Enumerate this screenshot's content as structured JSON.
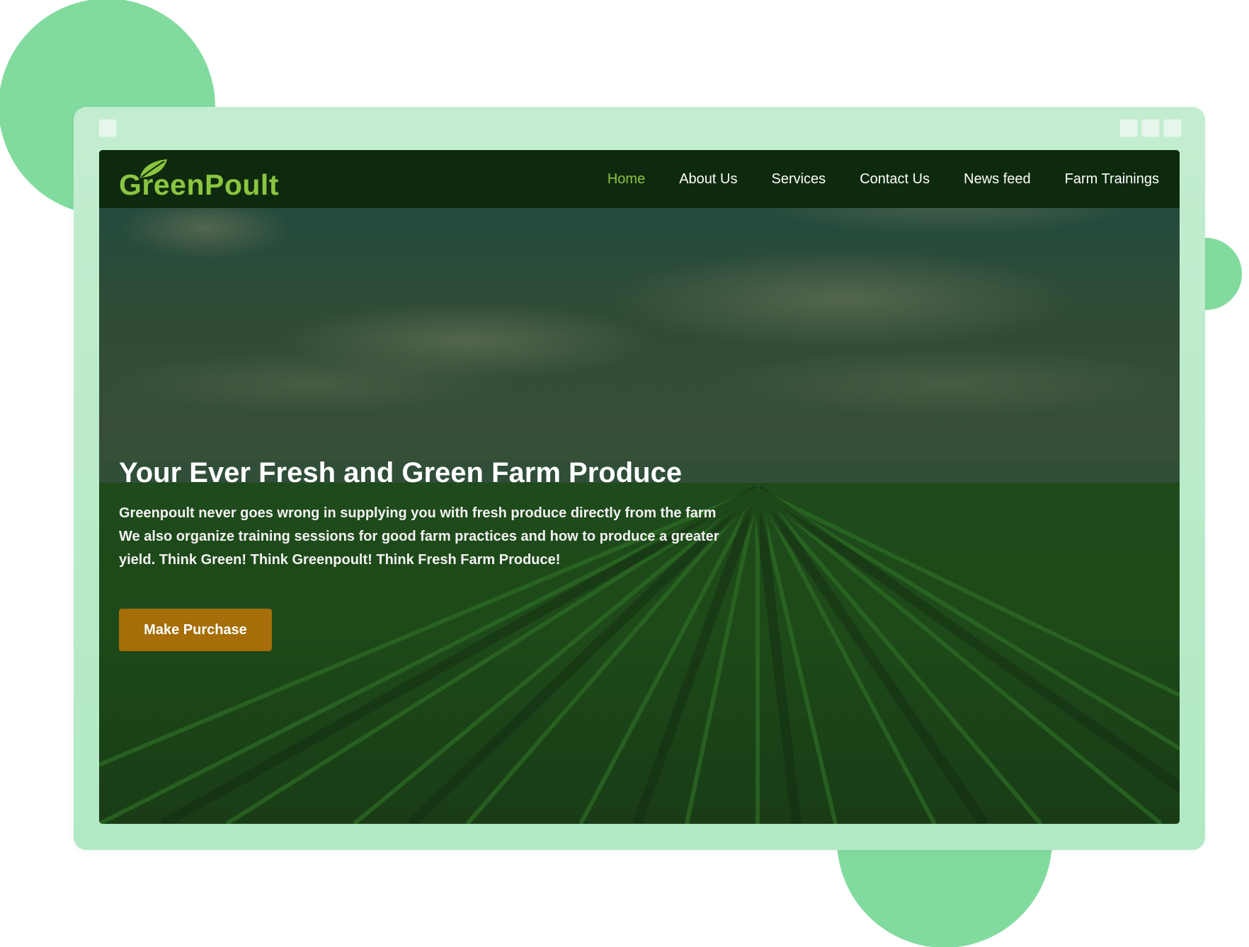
{
  "colors": {
    "brand_green": "#8bc541",
    "nav_background": "#0e2a0e",
    "cta_background": "#a56e08",
    "frame": "#c3edd0",
    "decor_circles": "#82db9e"
  },
  "logo": {
    "text": "GreenPoult",
    "icon": "leaf-icon"
  },
  "nav": {
    "items": [
      {
        "label": "Home",
        "active": true
      },
      {
        "label": "About Us",
        "active": false
      },
      {
        "label": "Services",
        "active": false
      },
      {
        "label": "Contact Us",
        "active": false
      },
      {
        "label": "News feed",
        "active": false
      },
      {
        "label": "Farm Trainings",
        "active": false
      }
    ]
  },
  "hero": {
    "title": "Your Ever Fresh and Green Farm Produce",
    "lines": [
      "Greenpoult never goes wrong in supplying you with fresh produce directly from the farm",
      "We also organize training sessions for good farm practices and how to produce a greater",
      "yield.  Think Green! Think Greenpoult! Think Fresh Farm Produce!"
    ],
    "cta_label": "Make Purchase"
  }
}
